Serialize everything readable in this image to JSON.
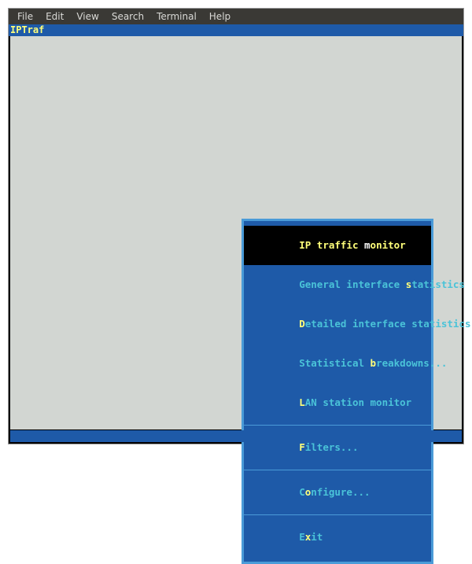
{
  "menubar": {
    "items": [
      "File",
      "Edit",
      "View",
      "Search",
      "Terminal",
      "Help"
    ]
  },
  "app_title": "IPTraf",
  "menu": {
    "groups": [
      [
        {
          "pre": "IP traffic ",
          "hk": "m",
          "post": "onitor",
          "selected": true
        },
        {
          "pre": "General interface ",
          "hk": "s",
          "post": "tatistics",
          "selected": false
        },
        {
          "pre": "",
          "hk": "D",
          "post": "etailed interface statistics",
          "selected": false
        },
        {
          "pre": "Statistical ",
          "hk": "b",
          "post": "reakdowns...",
          "selected": false
        },
        {
          "pre": "",
          "hk": "L",
          "post": "AN station monitor",
          "selected": false
        }
      ],
      [
        {
          "pre": "",
          "hk": "F",
          "post": "ilters...",
          "selected": false
        }
      ],
      [
        {
          "pre": "C",
          "hk": "o",
          "post": "nfigure...",
          "selected": false
        }
      ],
      [
        {
          "pre": "E",
          "hk": "x",
          "post": "it",
          "selected": false
        }
      ]
    ]
  }
}
